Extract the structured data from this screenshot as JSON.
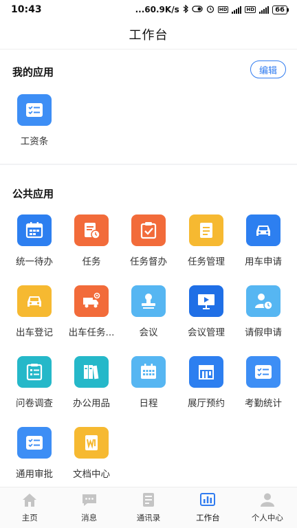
{
  "status_bar": {
    "time": "10:43",
    "speed": "...60.9K/s",
    "network_1": "4G",
    "network_2": "4G",
    "hd_1": "HD",
    "hd_2": "HD",
    "battery": "66"
  },
  "header": {
    "title": "工作台"
  },
  "my_apps": {
    "title": "我的应用",
    "edit_label": "编辑",
    "items": [
      {
        "label": "工资条",
        "icon": "checklist-icon",
        "color": "#3d8ef5"
      }
    ]
  },
  "public_apps": {
    "title": "公共应用",
    "items": [
      {
        "label": "统一待办",
        "icon": "calendar-icon",
        "color": "#2d7ff0"
      },
      {
        "label": "任务",
        "icon": "task-clock-icon",
        "color": "#f26b3a"
      },
      {
        "label": "任务督办",
        "icon": "clipboard-check-icon",
        "color": "#f26b3a"
      },
      {
        "label": "任务管理",
        "icon": "document-icon",
        "color": "#f6b931"
      },
      {
        "label": "用车申请",
        "icon": "car-icon",
        "color": "#2d7ff0"
      },
      {
        "label": "出车登记",
        "icon": "car-icon",
        "color": "#f6b931"
      },
      {
        "label": "出车任务...",
        "icon": "truck-icon",
        "color": "#f26b3a"
      },
      {
        "label": "会议",
        "icon": "stamp-icon",
        "color": "#56b6f2"
      },
      {
        "label": "会议管理",
        "icon": "presentation-icon",
        "color": "#1f6fe6"
      },
      {
        "label": "请假申请",
        "icon": "person-clock-icon",
        "color": "#56b6f2"
      },
      {
        "label": "问卷调查",
        "icon": "survey-icon",
        "color": "#25b8c9"
      },
      {
        "label": "办公用品",
        "icon": "binders-icon",
        "color": "#25b8c9"
      },
      {
        "label": "日程",
        "icon": "schedule-icon",
        "color": "#56b6f2"
      },
      {
        "label": "展厅预约",
        "icon": "store-icon",
        "color": "#2d7ff0"
      },
      {
        "label": "考勤统计",
        "icon": "checklist-icon",
        "color": "#3d8ef5"
      },
      {
        "label": "通用审批",
        "icon": "checklist-icon",
        "color": "#3d8ef5"
      },
      {
        "label": "文档中心",
        "icon": "word-doc-icon",
        "color": "#f6b931"
      }
    ]
  },
  "tabbar": {
    "active_color": "#2f7bf0",
    "inactive_color": "#c4c4c4",
    "items": [
      {
        "label": "主页",
        "icon": "home-icon",
        "active": false
      },
      {
        "label": "消息",
        "icon": "message-icon",
        "active": false
      },
      {
        "label": "通讯录",
        "icon": "contacts-icon",
        "active": false
      },
      {
        "label": "工作台",
        "icon": "workbench-icon",
        "active": true
      },
      {
        "label": "个人中心",
        "icon": "person-icon",
        "active": false
      }
    ]
  }
}
